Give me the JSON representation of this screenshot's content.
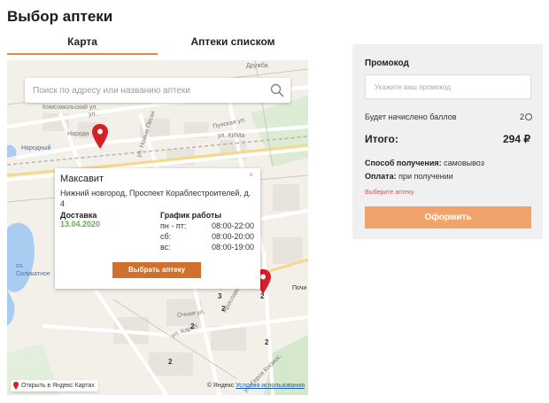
{
  "page": {
    "title": "Выбор аптеки"
  },
  "tabs": [
    {
      "label": "Карта",
      "active": true
    },
    {
      "label": "Аптеки списком",
      "active": false
    }
  ],
  "map": {
    "search_placeholder": "Поиск по адресу или названию аптеки",
    "labels": {
      "druzhba": "Дружба",
      "komsomolsky": "Комсомольский ул.",
      "khodovaya": "ул.",
      "narodnaya": "Народн",
      "narodny": "Народный",
      "novaya_peski": "ул. Новые Пески",
      "kima": "ул. КИМа",
      "punskaya": "Пунская ул.",
      "ozero": "оз. Силикатное",
      "pochinki": "Почи",
      "ochnaya": "Очная ул.",
      "karabolskaya": "ул. Караб.",
      "yaroslavskaya": "Ярославская ул.",
      "gerasima": "ул. Героя Космос."
    },
    "cluster_counts": [
      "2",
      "3",
      "2",
      "2",
      "2",
      "2"
    ],
    "open_in_yandex": "Открыть в Яндекс Картах",
    "copyright": "© Яндекс",
    "terms_link": "Условия использования"
  },
  "popup": {
    "close": "×",
    "store_name": "Максавит",
    "address": "Нижний новгород, Проспект Кораблестроителей, д. 4",
    "delivery_label": "Доставка",
    "delivery_date": "13.04.2020",
    "schedule_title": "График работы",
    "schedule": [
      {
        "day": "пн - пт:",
        "time": "08:00-22:00"
      },
      {
        "day": "сб:",
        "time": "08:00-20:00"
      },
      {
        "day": "вс:",
        "time": "08:00-19:00"
      }
    ],
    "choose_button": "Выбрать аптеку"
  },
  "panel": {
    "promo_title": "Промокод",
    "promo_placeholder": "Укажите ваш промокод",
    "points_label": "Будет начислено баллов",
    "points_value": "2",
    "total_label": "Итого:",
    "total_value": "294 ₽",
    "method_label": "Способ получения:",
    "method_value": "самовывоз",
    "pay_label": "Оплата:",
    "pay_value": "при получении",
    "warning": "Выберите аптеку",
    "order_button": "Оформить"
  },
  "colors": {
    "accent": "#e9834a",
    "choose_button": "#d0702d",
    "order_button": "#f0a46b",
    "pin": "#d51f26",
    "date_green": "#6aa84f",
    "warning": "#d9534f"
  }
}
